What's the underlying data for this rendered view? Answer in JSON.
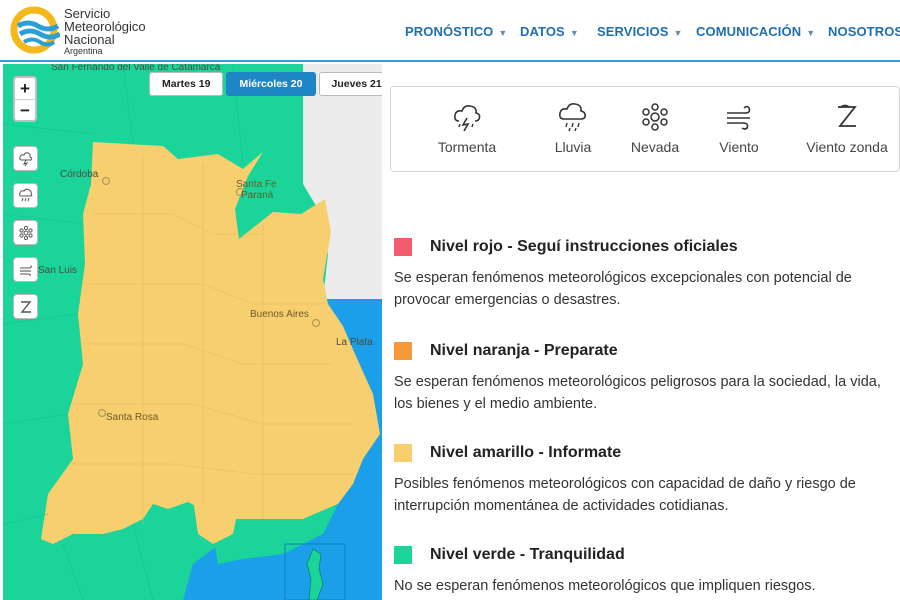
{
  "brand": {
    "line1": "Servicio",
    "line2": "Meteorológico",
    "line3": "Nacional",
    "line4": "Argentina"
  },
  "nav": [
    {
      "label": "PRONÓSTICO",
      "has_caret": true
    },
    {
      "label": "DATOS",
      "has_caret": true
    },
    {
      "label": "SERVICIOS",
      "has_caret": true
    },
    {
      "label": "COMUNICACIÓN",
      "has_caret": true
    },
    {
      "label": "NOSOTROS",
      "has_caret": false
    }
  ],
  "map": {
    "zoom_in": "+",
    "zoom_out": "−",
    "days": [
      {
        "label": "Martes 19",
        "selected": false
      },
      {
        "label": "Miércoles 20",
        "selected": true
      },
      {
        "label": "Jueves 21",
        "selected": false
      }
    ],
    "tools": [
      "storm-icon",
      "rain-icon",
      "snow-icon",
      "wind-icon",
      "zonda-icon"
    ],
    "labels": {
      "catamarca": "San Fernando del Valle de Catamarca",
      "cordoba": "Córdoba",
      "santa_fe": "Santa Fe",
      "parana": "Paraná",
      "san_luis": "San Luis",
      "buenos_aires": "Buenos Aires",
      "la_plata": "La Plata",
      "santa_rosa": "Santa Rosa"
    },
    "colors": {
      "green": "#1ad49a",
      "yellow": "#f7cf6f",
      "water": "#1a9fe8",
      "land": "#ececec"
    }
  },
  "phenomena": [
    {
      "icon": "storm-icon",
      "label": "Tormenta"
    },
    {
      "icon": "rain-icon",
      "label": "Lluvia"
    },
    {
      "icon": "snow-icon",
      "label": "Nevada"
    },
    {
      "icon": "wind-icon",
      "label": "Viento"
    },
    {
      "icon": "zonda-icon",
      "label": "Viento zonda"
    }
  ],
  "levels": [
    {
      "color": "#f25c6e",
      "title": "Nivel rojo - Seguí instrucciones oficiales",
      "description": "Se esperan fenómenos meteorológicos excepcionales con potencial de provocar emergencias o desastres."
    },
    {
      "color": "#f5993a",
      "title": "Nivel naranja - Preparate",
      "description": "Se esperan fenómenos meteorológicos peligrosos para la sociedad, la vida, los bienes y el medio ambiente."
    },
    {
      "color": "#f7cf6f",
      "title": "Nivel amarillo - Informate",
      "description": "Posibles fenómenos meteorológicos con capacidad de daño y riesgo de interrupción momentánea de actividades cotidianas."
    },
    {
      "color": "#1ad49a",
      "title": "Nivel verde - Tranquilidad",
      "description": "No se esperan fenómenos meteorológicos que impliquen riesgos."
    }
  ]
}
